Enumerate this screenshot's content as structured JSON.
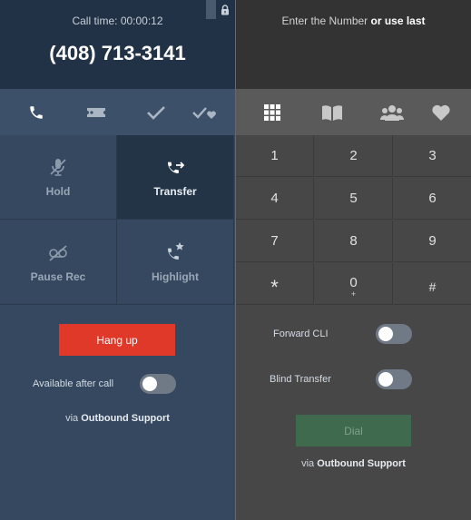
{
  "call": {
    "time_label": "Call time: 00:00:12",
    "phone_number": "(408) 713-3141"
  },
  "dialer": {
    "enter_prefix": "Enter the Number ",
    "enter_bold": "or use last"
  },
  "left_tabs": [
    "phone-icon",
    "ticket-icon",
    "check-icon",
    "double-check-heart-icon"
  ],
  "right_tabs": [
    "keypad-icon",
    "book-icon",
    "group-icon",
    "heart-icon"
  ],
  "actions": {
    "hold": "Hold",
    "transfer": "Transfer",
    "pause_rec": "Pause Rec",
    "highlight": "Highlight"
  },
  "keypad": {
    "k1": "1",
    "k2": "2",
    "k3": "3",
    "k4": "4",
    "k5": "5",
    "k6": "6",
    "k7": "7",
    "k8": "8",
    "k9": "9",
    "kstar": "*",
    "k0": "0",
    "k0_sub": "+",
    "khash": "#"
  },
  "left_bottom": {
    "hangup_label": "Hang up",
    "available_label": "Available after call",
    "available_on": false,
    "via_prefix": "via ",
    "via_bold": "Outbound Support"
  },
  "right_bottom": {
    "forward_cli_label": "Forward CLI",
    "forward_cli_on": false,
    "blind_transfer_label": "Blind Transfer",
    "blind_transfer_on": false,
    "dial_label": "Dial",
    "via_prefix": "via ",
    "via_bold": "Outbound Support"
  },
  "colors": {
    "hangup": "#e0392a",
    "dial_disabled": "#3f6a4e",
    "left_panel": "#35485f",
    "right_panel": "#474747"
  }
}
